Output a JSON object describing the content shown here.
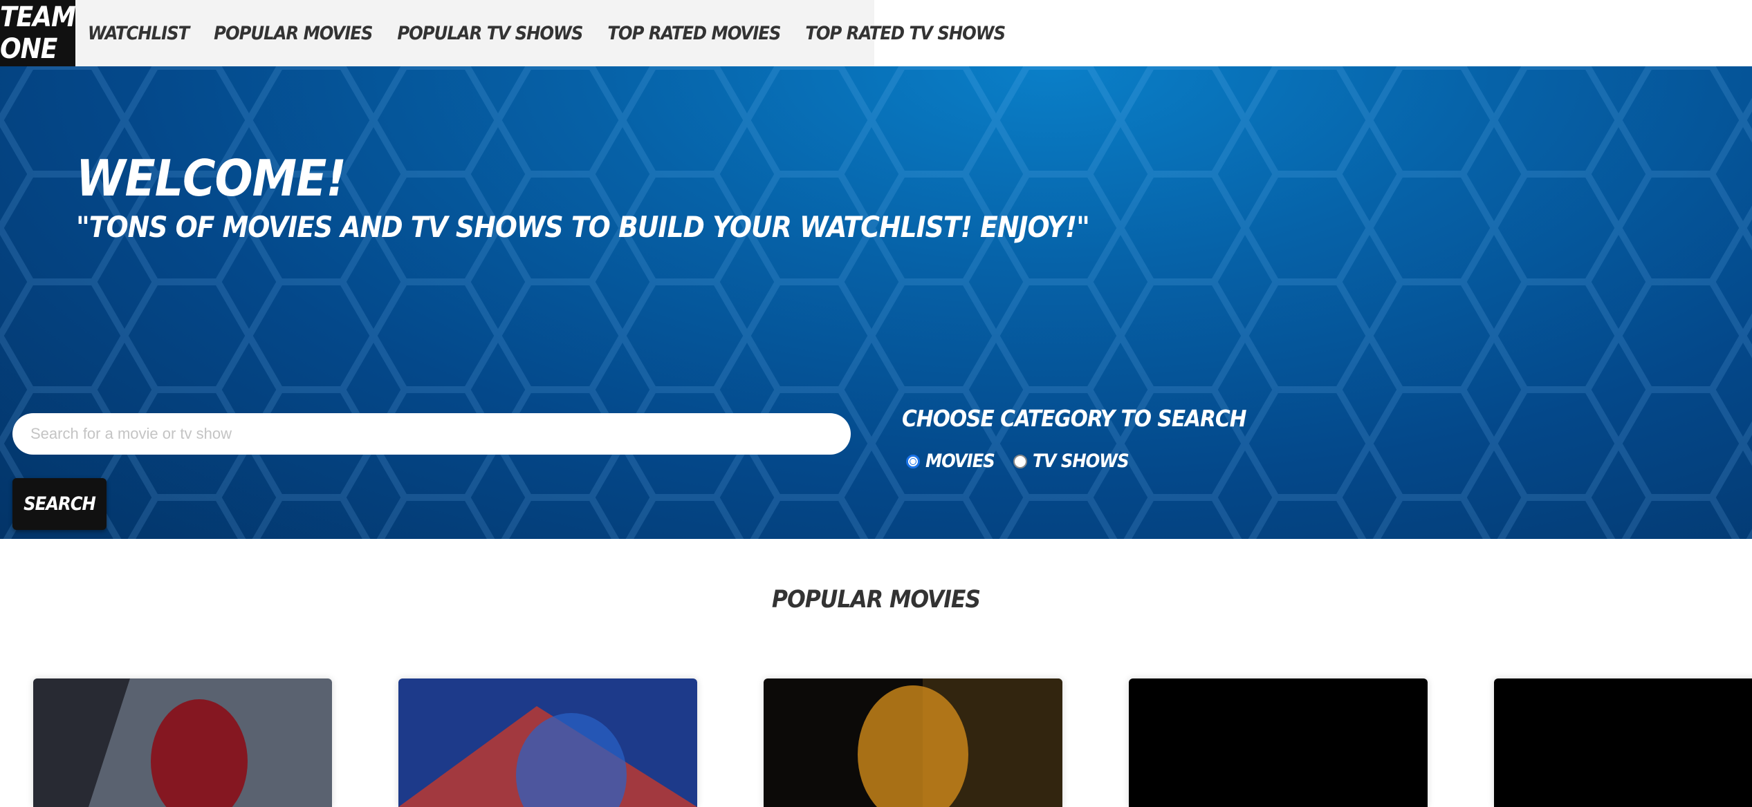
{
  "nav": {
    "brand": "TEAM ONE",
    "links": [
      "WATCHLIST",
      "POPULAR MOVIES",
      "POPULAR TV SHOWS",
      "TOP RATED MOVIES",
      "TOP RATED TV SHOWS"
    ]
  },
  "hero": {
    "welcome": "WELCOME!",
    "tagline": "\"TONS OF MOVIES AND TV SHOWS TO BUILD YOUR WATCHLIST! ENJOY!\""
  },
  "search": {
    "placeholder": "Search for a movie or tv show",
    "value": "",
    "button_label": "SEARCH"
  },
  "category": {
    "title": "CHOOSE CATEGORY TO SEARCH",
    "options": [
      {
        "label": "MOVIES",
        "checked": true
      },
      {
        "label": "TV SHOWS",
        "checked": false
      }
    ]
  },
  "popular": {
    "title": "POPULAR MOVIES",
    "posters": [
      {
        "icon": "movie-poster-image",
        "colors": [
          "#5a6270",
          "#1b1d24",
          "#8a1018"
        ]
      },
      {
        "icon": "movie-poster-image",
        "colors": [
          "#0e4a3c",
          "#3e3322",
          "#c8691c"
        ]
      },
      {
        "icon": "movie-poster-image",
        "colors": [
          "#1d3a8a",
          "#c43a2c",
          "#2a63c8"
        ]
      },
      {
        "icon": "movie-poster-image",
        "colors": [
          "#c8d8e8",
          "#9ab4c8",
          "#3d5a38"
        ]
      },
      {
        "icon": "movie-poster-image",
        "colors": [
          "#0c0a08",
          "#3a2a10",
          "#d08a1a"
        ]
      }
    ]
  },
  "colors": {
    "brand_bg": "#111111",
    "nav_bg": "#f3f3f3",
    "hero_blue": "#04488a",
    "accent": "#1a73e8"
  }
}
